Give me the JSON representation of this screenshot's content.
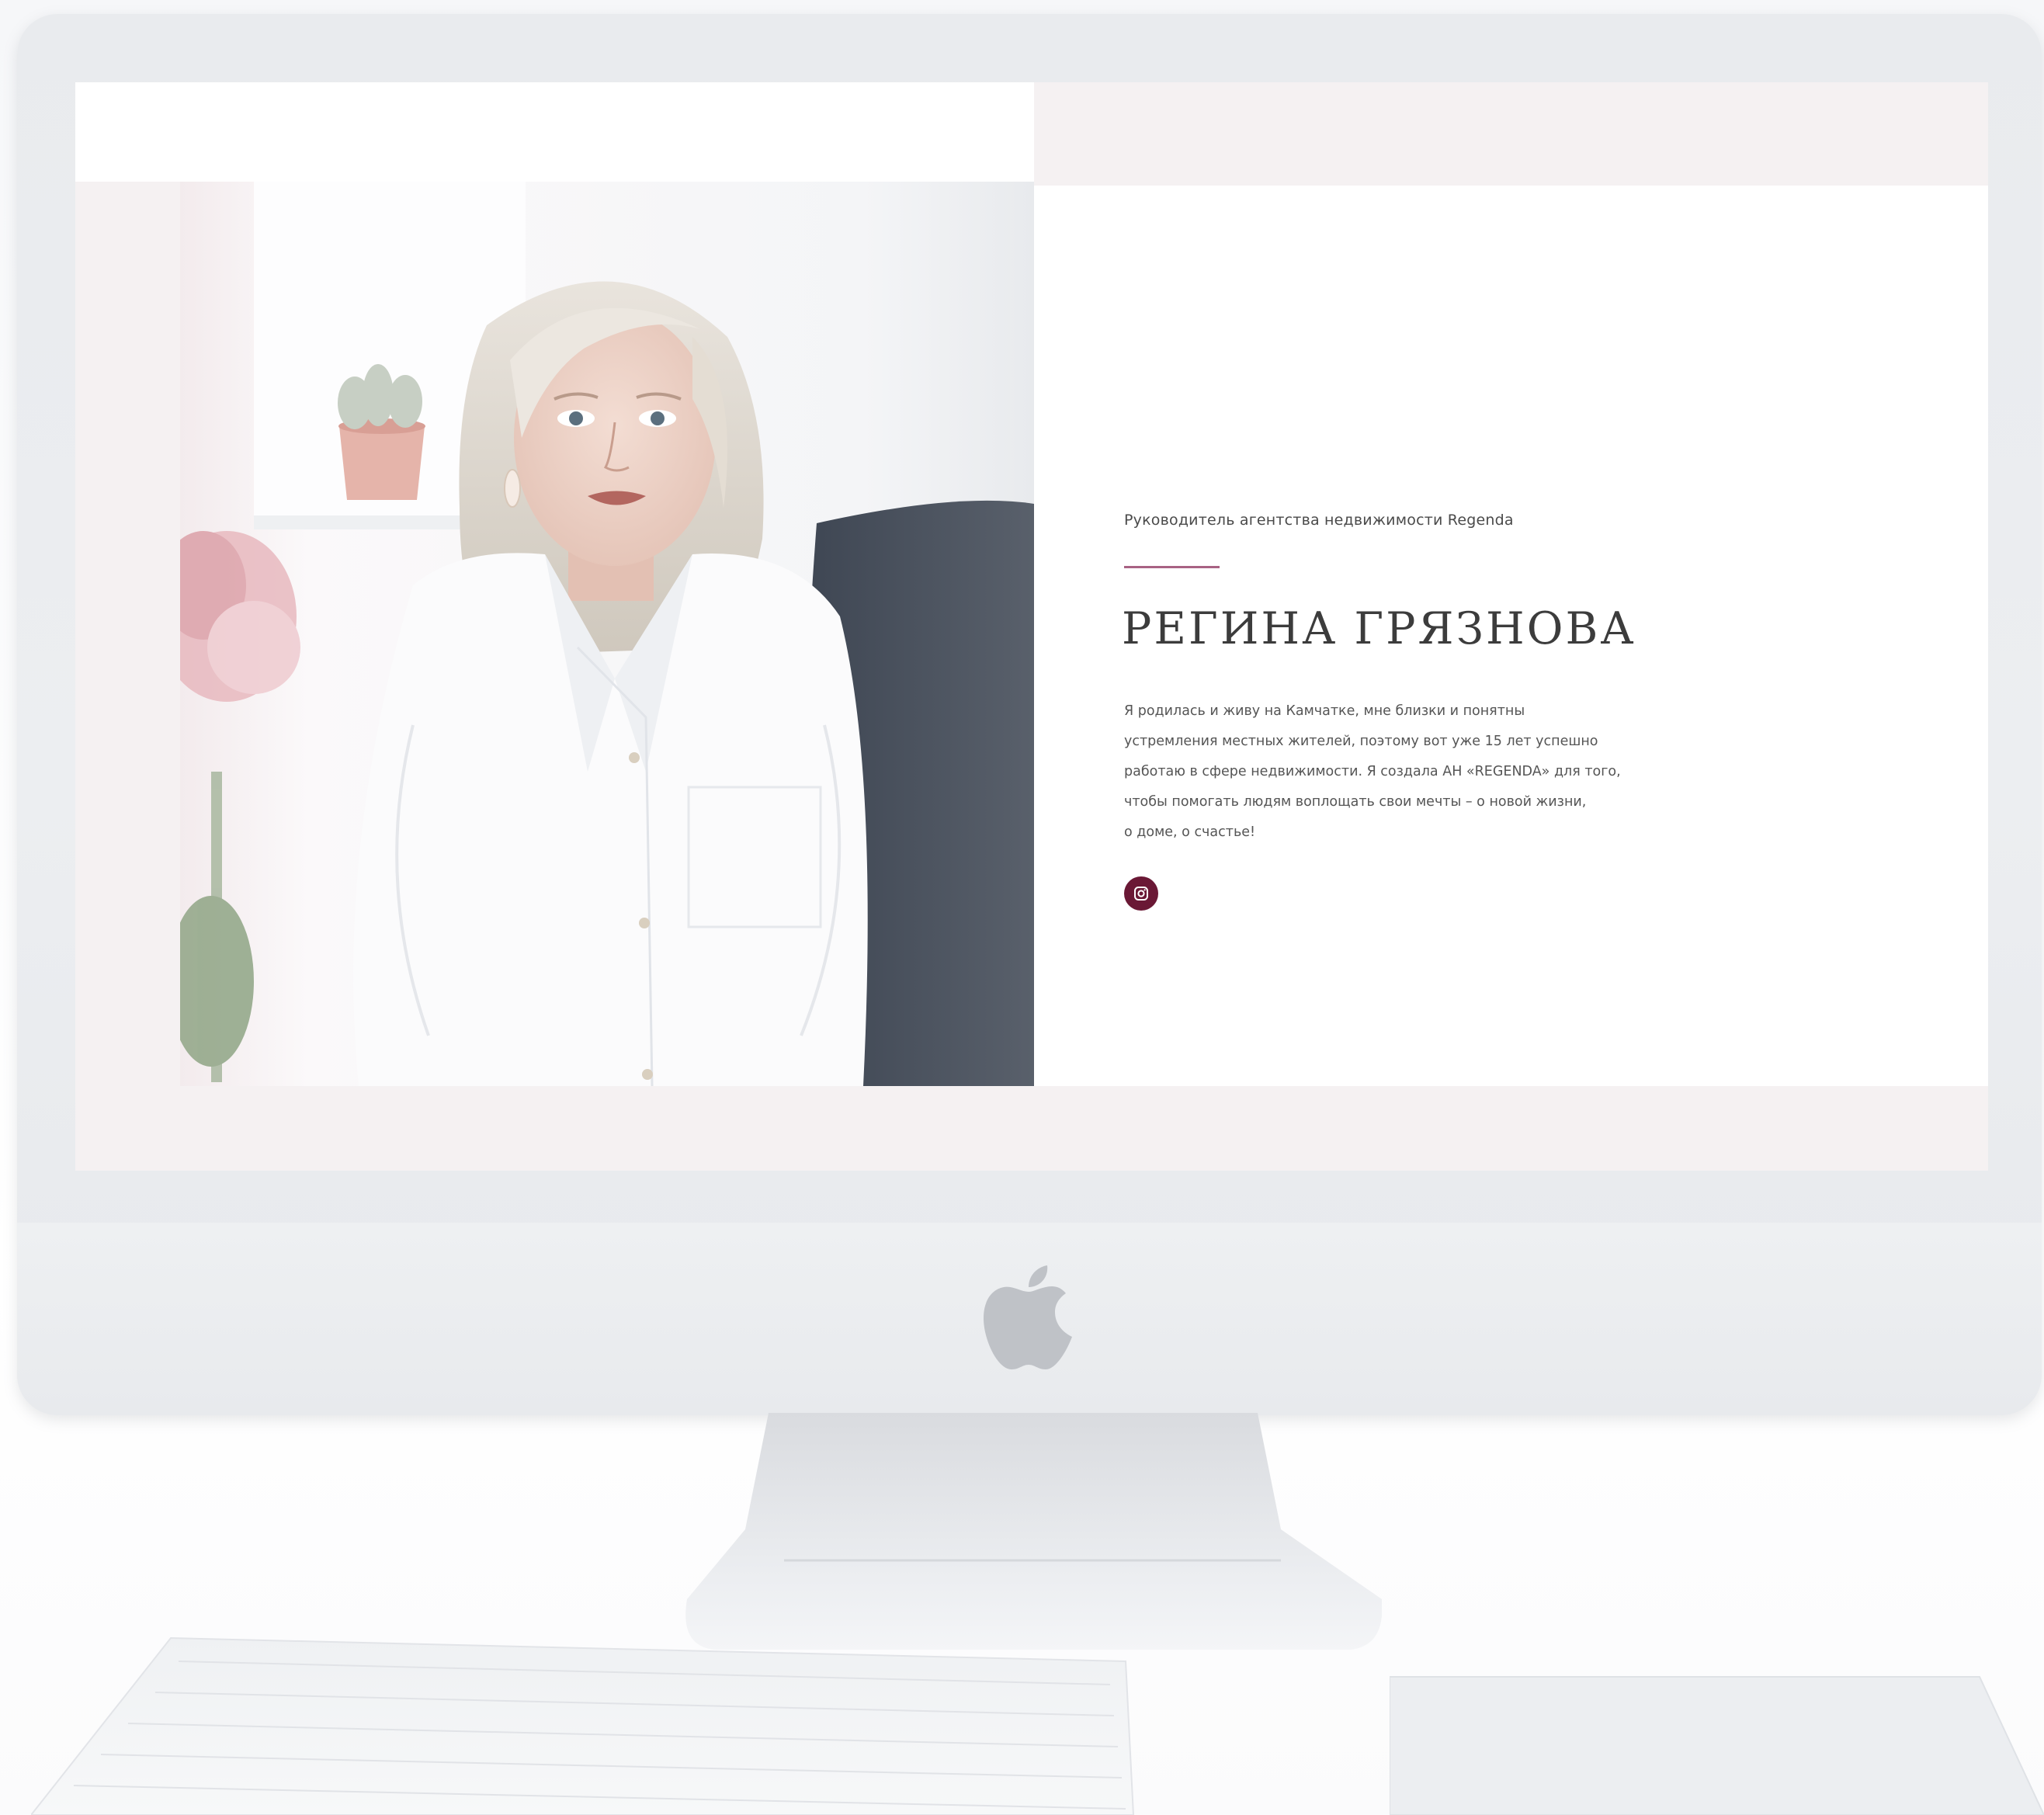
{
  "profile": {
    "subtitle": "Руководитель агентства недвижимости Regenda",
    "name": "РЕГИНА ГРЯЗНОВА",
    "bio_lines": [
      "Я родилась и живу на Камчатке, мне близки и понятны",
      "устремления местных жителей, поэтому вот уже 15 лет успешно",
      "работаю в сфере недвижимости. Я создала АН «REGENDA» для того,",
      "чтобы помогать людям воплощать свои мечты – о новой жизни,",
      "о доме, о счастье!"
    ]
  },
  "social": {
    "instagram_icon": "instagram-icon"
  },
  "colors": {
    "accent": "#a86283",
    "button": "#6a1835",
    "screen_bg": "#f5f1f2"
  }
}
